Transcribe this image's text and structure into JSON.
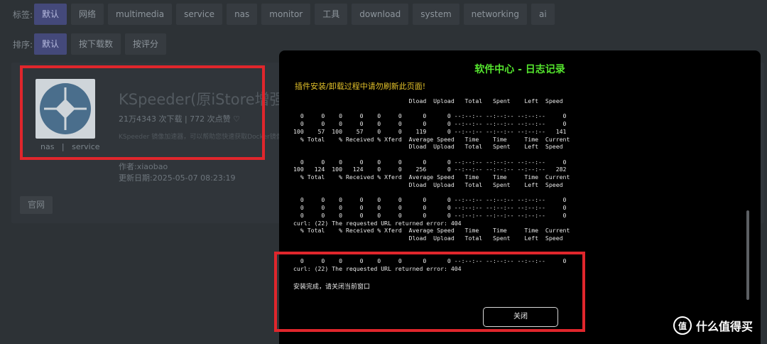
{
  "filters": {
    "tags_label": "标签:",
    "tags": [
      "默认",
      "网络",
      "multimedia",
      "service",
      "nas",
      "monitor",
      "工具",
      "download",
      "system",
      "networking",
      "ai"
    ],
    "sort_label": "排序:",
    "sort": [
      "默认",
      "按下载数",
      "按评分"
    ]
  },
  "app": {
    "title": "KSpeeder(原iStore增强",
    "stats": "21万4343 次下载  |  772 次点赞  ♡",
    "description": "KSpeeder 镜像加速器，可以帮助您快速获取Docker镜像，提升使用体验",
    "tags": "nas   |   service",
    "author": "作者:xiaobao",
    "updated": "更新日期:2025-05-07 08:23:19",
    "website_label": "官网"
  },
  "modal": {
    "title": "软件中心 - 日志记录",
    "warning": "插件安装/卸载过程中请勿刷新此页面!",
    "log_lines": [
      "                                 Dload  Upload   Total   Spent    Left  Speed",
      "",
      "  0     0    0     0    0     0      0      0 --:--:-- --:--:-- --:--:--     0",
      "  0     0    0     0    0     0      0      0 --:--:-- --:--:-- --:--:--     0",
      "100    57  100    57    0     0    119      0 --:--:-- --:--:-- --:--:--   141",
      "  % Total    % Received % Xferd  Average Speed   Time    Time     Time  Current",
      "                                 Dload  Upload   Total   Spent    Left  Speed",
      "",
      "  0     0    0     0    0     0      0      0 --:--:-- --:--:-- --:--:--     0",
      "100   124  100   124    0     0    256      0 --:--:-- --:--:-- --:--:--   282",
      "  % Total    % Received % Xferd  Average Speed   Time    Time     Time  Current",
      "                                 Dload  Upload   Total   Spent    Left  Speed",
      "",
      "  0     0    0     0    0     0      0      0 --:--:-- --:--:-- --:--:--     0",
      "  0     0    0     0    0     0      0      0 --:--:-- --:--:-- --:--:--     0",
      "  0     0    0     0    0     0      0      0 --:--:-- --:--:-- --:--:--     0",
      "curl: (22) The requested URL returned error: 404",
      "  % Total    % Received % Xferd  Average Speed   Time    Time     Time  Current",
      "                                 Dload  Upload   Total   Spent    Left  Speed",
      "",
      "",
      "  0     0    0     0    0     0      0      0 --:--:-- --:--:-- --:--:--     0",
      "curl: (22) The requested URL returned error: 404"
    ],
    "done_message": "安装完成，请关闭当前窗口",
    "close_label": "关闭"
  },
  "watermark": {
    "logo_glyph": "值",
    "text": "什么值得买"
  },
  "colors": {
    "title_green": "#55e62e",
    "warning_yellow": "#e2c12a",
    "highlight_red": "#e0262c",
    "active_chip": "#44497a"
  }
}
